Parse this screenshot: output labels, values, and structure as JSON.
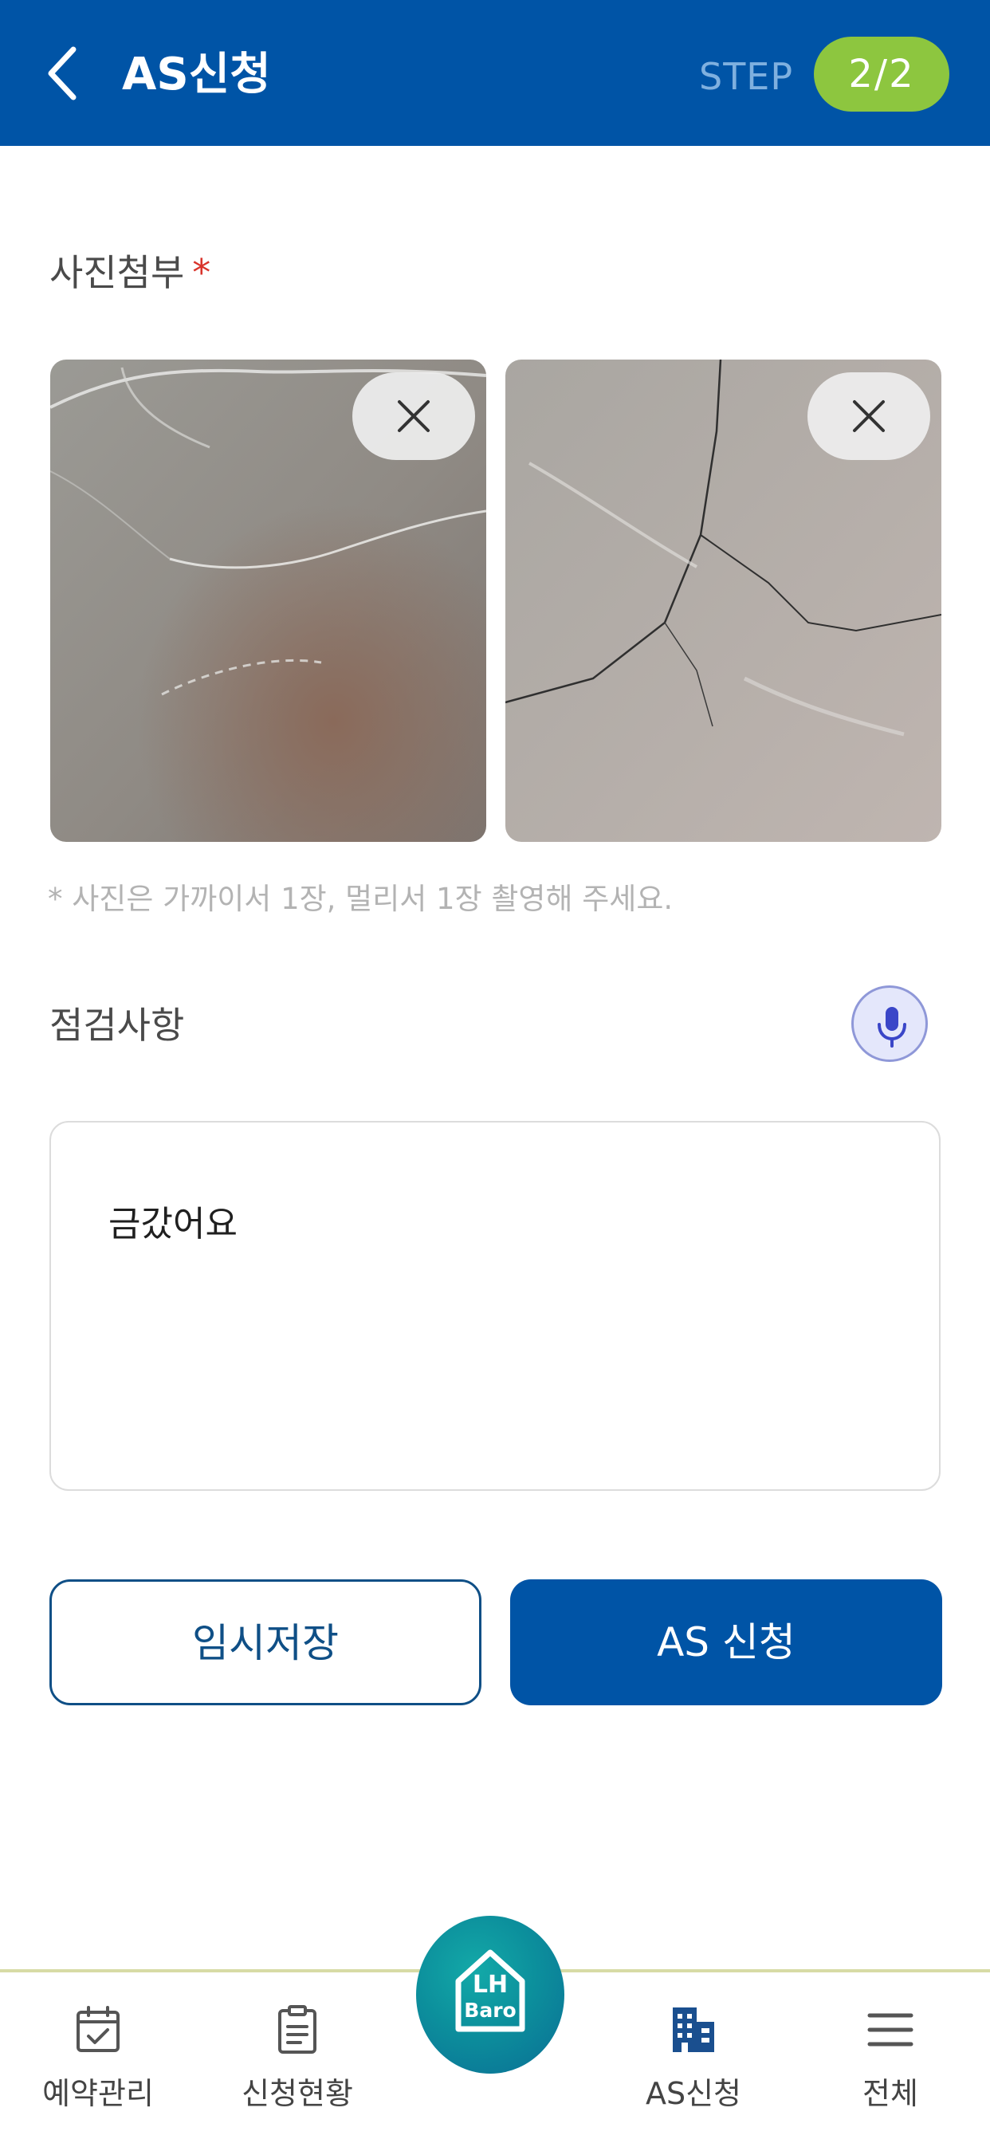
{
  "header": {
    "title": "AS신청",
    "step_label": "STEP",
    "step_value": "2/2",
    "colors": {
      "bar": "#0054a6",
      "step_badge": "#8dc63f"
    },
    "icons": {
      "back": "chevron-left-icon"
    }
  },
  "photo_section": {
    "title": "사진첨부",
    "required_mark": "*",
    "photos": [
      {
        "remove_icon": "close-icon"
      },
      {
        "remove_icon": "close-icon"
      }
    ],
    "hint": "* 사진은 가까이서 1장, 멀리서 1장 촬영해 주세요."
  },
  "inspection": {
    "title": "점검사항",
    "mic_icon": "microphone-icon",
    "text": "금갔어요"
  },
  "actions": {
    "temp_save_label": "임시저장",
    "submit_label": "AS 신청"
  },
  "bottom_nav": {
    "items": [
      {
        "label": "예약관리",
        "icon": "calendar-check-icon"
      },
      {
        "label": "신청현황",
        "icon": "clipboard-icon"
      },
      {
        "label": "AS신청",
        "icon": "building-icon",
        "active": true
      },
      {
        "label": "전체",
        "icon": "menu-icon"
      }
    ],
    "home": {
      "logo_line1": "LH",
      "logo_line2": "Baro",
      "icon": "home-logo-icon"
    }
  }
}
